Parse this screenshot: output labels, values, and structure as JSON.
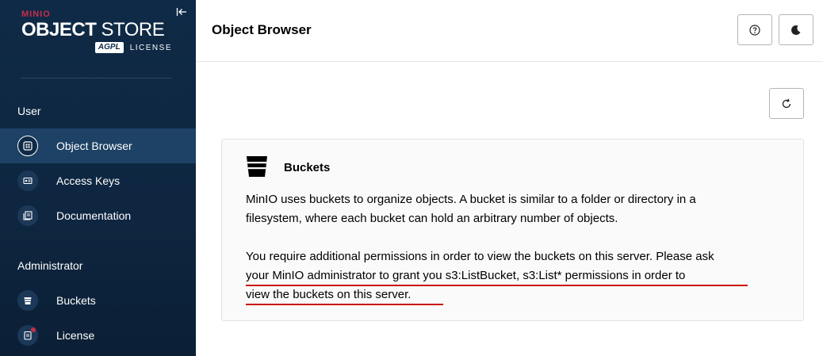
{
  "app": {
    "brand": "MINIO",
    "title_bold": "OBJECT",
    "title_light": "STORE",
    "badge": "AGPL",
    "license_text": "LICENSE"
  },
  "sidebar": {
    "sections": [
      {
        "label": "User",
        "items": [
          {
            "label": "Object Browser",
            "icon": "object-browser-icon",
            "active": true
          },
          {
            "label": "Access Keys",
            "icon": "access-keys-icon",
            "active": false
          },
          {
            "label": "Documentation",
            "icon": "documentation-icon",
            "active": false
          }
        ]
      },
      {
        "label": "Administrator",
        "items": [
          {
            "label": "Buckets",
            "icon": "bucket-icon",
            "active": false
          },
          {
            "label": "License",
            "icon": "license-icon",
            "active": false
          }
        ]
      }
    ]
  },
  "header": {
    "title": "Object Browser"
  },
  "info": {
    "title": "Buckets",
    "paragraph1_line1": "MinIO uses buckets to organize objects. A bucket is similar to a folder or directory in a",
    "paragraph1_line2": "filesystem, where each bucket can hold an arbitrary number of objects.",
    "paragraph2_line1": "You require additional permissions in order to view the buckets on this server. Please ask",
    "paragraph2_line2": "your MinIO administrator to grant you s3:ListBucket, s3:List* permissions in order to",
    "paragraph2_line3": "view the buckets on this server."
  },
  "colors": {
    "sidebar_bg": "#0f2a46",
    "active_item_bg": "#1d4265",
    "brand_red": "#c72e49",
    "annotation_red": "#c90c0c"
  }
}
